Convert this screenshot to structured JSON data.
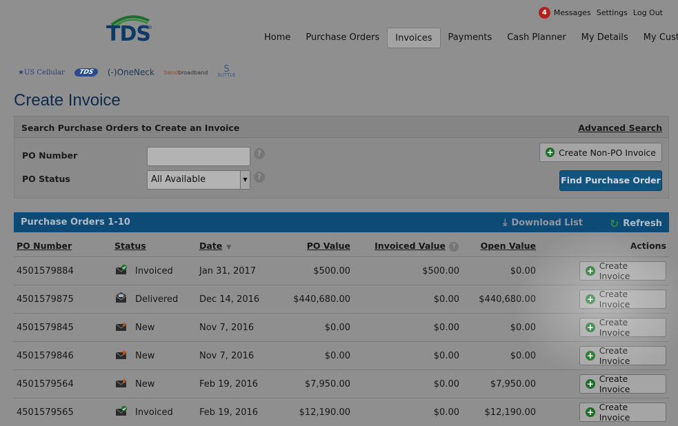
{
  "header": {
    "logo_text": "TDS",
    "logo_mark": "®",
    "messages_count": "4",
    "messages_label": "Messages",
    "settings_label": "Settings",
    "logout_label": "Log Out"
  },
  "nav": {
    "items": [
      "Home",
      "Purchase Orders",
      "Invoices",
      "Payments",
      "Cash Planner",
      "My Details",
      "My Customer"
    ],
    "active": "Invoices"
  },
  "brands": {
    "us_cellular": "US Cellular",
    "tds": "TDS",
    "oneneck": "OneNeck",
    "bend": "bend",
    "broadband": "broadband",
    "suttle_s": "S",
    "suttle": "SUTTLE"
  },
  "page": {
    "title": "Create Invoice"
  },
  "search": {
    "title": "Search Purchase Orders to Create an Invoice",
    "advanced_link": "Advanced Search",
    "po_number_label": "PO Number",
    "po_number_value": "",
    "po_status_label": "PO Status",
    "po_status_value": "All Available",
    "help_glyph": "?",
    "non_po_button": "Create Non-PO Invoice",
    "find_button": "Find Purchase Order"
  },
  "results": {
    "title": "Purchase Orders 1-10",
    "download_label": "Download List",
    "refresh_label": "Refresh",
    "columns": {
      "po_number": "PO Number",
      "status": "Status",
      "date": "Date",
      "po_value": "PO Value",
      "invoiced_value": "Invoiced Value",
      "open_value": "Open Value",
      "actions": "Actions"
    },
    "action_label": "Create Invoice",
    "rows": [
      {
        "po": "4501579884",
        "status": "Invoiced",
        "icon": "invoiced-mail-icon",
        "date": "Jan 31, 2017",
        "po_value": "$500.00",
        "invoiced": "$500.00",
        "open": "$0.00"
      },
      {
        "po": "4501579875",
        "status": "Delivered",
        "icon": "delivered-mail-icon",
        "date": "Dec 14, 2016",
        "po_value": "$440,680.00",
        "invoiced": "$0.00",
        "open": "$440,680.00"
      },
      {
        "po": "4501579845",
        "status": "New",
        "icon": "new-mail-icon",
        "date": "Nov 7, 2016",
        "po_value": "$0.00",
        "invoiced": "$0.00",
        "open": "$0.00"
      },
      {
        "po": "4501579846",
        "status": "New",
        "icon": "new-mail-icon",
        "date": "Nov 7, 2016",
        "po_value": "$0.00",
        "invoiced": "$0.00",
        "open": "$0.00"
      },
      {
        "po": "4501579564",
        "status": "New",
        "icon": "new-mail-icon",
        "date": "Feb 19, 2016",
        "po_value": "$7,950.00",
        "invoiced": "$0.00",
        "open": "$7,950.00"
      },
      {
        "po": "4501579565",
        "status": "Invoiced",
        "icon": "invoiced-mail-icon",
        "date": "Feb 19, 2016",
        "po_value": "$12,190.00",
        "invoiced": "$0.00",
        "open": "$12,190.00"
      }
    ]
  },
  "colors": {
    "overlay_bg": "#8f8f8f",
    "title_blue": "#0e2a49",
    "bar_blue": "#0e4a76",
    "button_blue": "#11557f",
    "plus_green": "#1d6e2a",
    "badge_red": "#b5201f"
  }
}
